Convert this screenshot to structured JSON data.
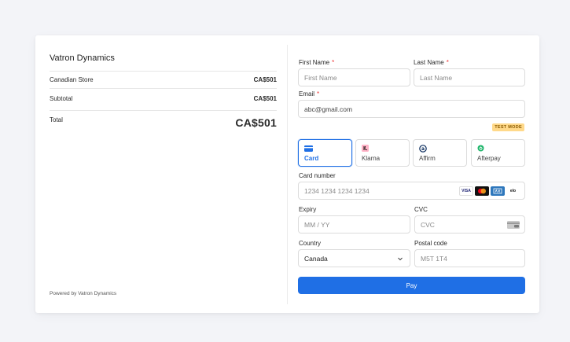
{
  "summary": {
    "merchant": "Vatron Dynamics",
    "store_label": "Canadian Store",
    "store_amount": "CA$501",
    "subtotal_label": "Subtotal",
    "subtotal_amount": "CA$501",
    "total_label": "Total",
    "total_amount": "CA$501",
    "powered_by": "Powered by Vatron Dynamics"
  },
  "form": {
    "first_name_label": "First Name",
    "first_name_placeholder": "First Name",
    "last_name_label": "Last Name",
    "last_name_placeholder": "Last Name",
    "email_label": "Email",
    "email_value": "abc@gmail.com",
    "required_mark": "*",
    "test_mode": "TEST MODE",
    "methods": [
      {
        "label": "Card",
        "icon": "card-icon"
      },
      {
        "label": "Klarna",
        "icon": "klarna-icon"
      },
      {
        "label": "Affirm",
        "icon": "affirm-icon"
      },
      {
        "label": "Afterpay",
        "icon": "afterpay-icon"
      }
    ],
    "card_number_label": "Card number",
    "card_number_placeholder": "1234 1234 1234 1234",
    "brands": [
      "VISA",
      "",
      "",
      "elo"
    ],
    "expiry_label": "Expiry",
    "expiry_placeholder": "MM / YY",
    "cvc_label": "CVC",
    "cvc_placeholder": "CVC",
    "country_label": "Country",
    "country_value": "Canada",
    "postal_label": "Postal code",
    "postal_placeholder": "M5T 1T4",
    "pay_label": "Pay"
  },
  "colors": {
    "accent": "#1f6fe5",
    "background": "#f3f4f8",
    "badge_bg": "#ffd98a"
  }
}
